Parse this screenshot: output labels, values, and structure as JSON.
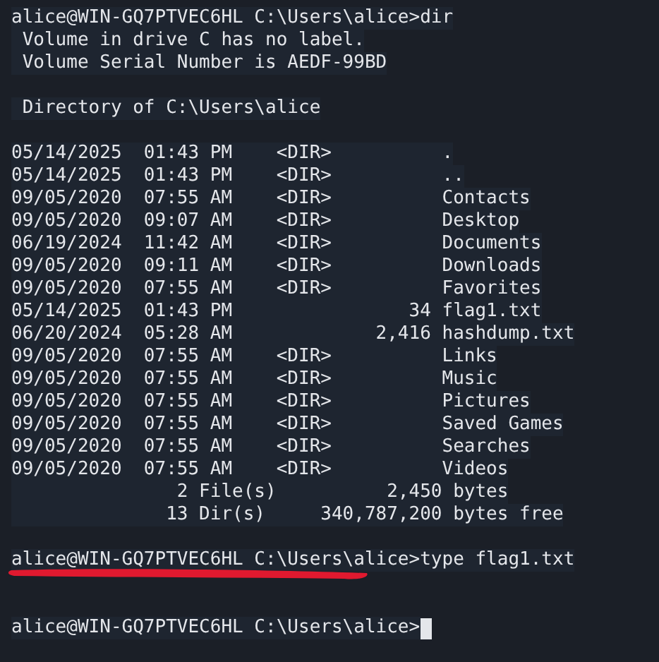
{
  "terminal": {
    "lines": [
      {
        "kind": "text",
        "text": "alice@WIN-GQ7PTVEC6HL C:\\Users\\alice>dir"
      },
      {
        "kind": "text",
        "text": " Volume in drive C has no label."
      },
      {
        "kind": "text",
        "text": " Volume Serial Number is AEDF-99BD"
      },
      {
        "kind": "blank"
      },
      {
        "kind": "text",
        "text": " Directory of C:\\Users\\alice"
      },
      {
        "kind": "blank"
      },
      {
        "kind": "text",
        "text": "05/14/2025  01:43 PM    <DIR>          ."
      },
      {
        "kind": "text",
        "text": "05/14/2025  01:43 PM    <DIR>          .."
      },
      {
        "kind": "text",
        "text": "09/05/2020  07:55 AM    <DIR>          Contacts"
      },
      {
        "kind": "text",
        "text": "09/05/2020  09:07 AM    <DIR>          Desktop"
      },
      {
        "kind": "text",
        "text": "06/19/2024  11:42 AM    <DIR>          Documents"
      },
      {
        "kind": "text",
        "text": "09/05/2020  09:11 AM    <DIR>          Downloads"
      },
      {
        "kind": "text",
        "text": "09/05/2020  07:55 AM    <DIR>          Favorites"
      },
      {
        "kind": "text",
        "text": "05/14/2025  01:43 PM                34 flag1.txt"
      },
      {
        "kind": "text",
        "text": "06/20/2024  05:28 AM             2,416 hashdump.txt"
      },
      {
        "kind": "text",
        "text": "09/05/2020  07:55 AM    <DIR>          Links"
      },
      {
        "kind": "text",
        "text": "09/05/2020  07:55 AM    <DIR>          Music"
      },
      {
        "kind": "text",
        "text": "09/05/2020  07:55 AM    <DIR>          Pictures"
      },
      {
        "kind": "text",
        "text": "09/05/2020  07:55 AM    <DIR>          Saved Games"
      },
      {
        "kind": "text",
        "text": "09/05/2020  07:55 AM    <DIR>          Searches"
      },
      {
        "kind": "text",
        "text": "09/05/2020  07:55 AM    <DIR>          Videos"
      },
      {
        "kind": "text",
        "text": "               2 File(s)          2,450 bytes"
      },
      {
        "kind": "text",
        "text": "              13 Dir(s)     340,787,200 bytes free"
      },
      {
        "kind": "blank"
      },
      {
        "kind": "text",
        "text": "alice@WIN-GQ7PTVEC6HL C:\\Users\\alice>type flag1.txt"
      },
      {
        "kind": "redacted"
      },
      {
        "kind": "blank"
      },
      {
        "kind": "prompt",
        "text": "alice@WIN-GQ7PTVEC6HL C:\\Users\\alice>"
      }
    ]
  }
}
